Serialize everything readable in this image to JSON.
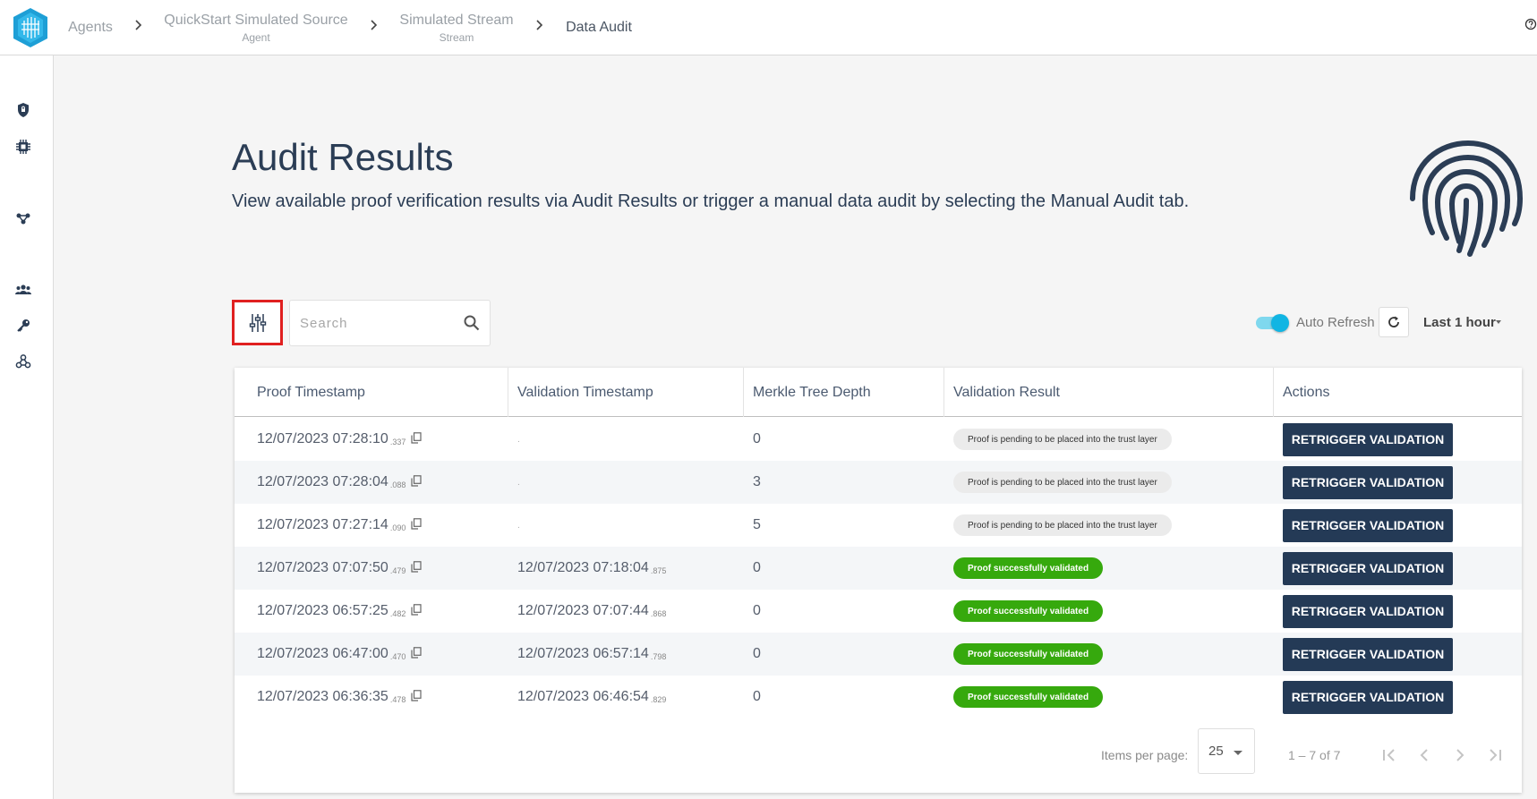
{
  "header": {
    "breadcrumbs": [
      {
        "label": "Agents",
        "sub": ""
      },
      {
        "label": "QuickStart Simulated Source",
        "sub": "Agent"
      },
      {
        "label": "Simulated Stream",
        "sub": "Stream"
      },
      {
        "label": "Data Audit",
        "sub": ""
      }
    ],
    "help_icon": "help-circle-icon"
  },
  "sidebar": {
    "icons": [
      "shield-icon",
      "chip-icon",
      "share-nodes-icon",
      "group-icon",
      "key-icon",
      "webhook-icon"
    ]
  },
  "hero": {
    "title": "Audit Results",
    "subtitle": "View available proof verification results via Audit Results or trigger a manual data audit by selecting the Manual Audit tab.",
    "icon": "fingerprint-icon"
  },
  "toolbar": {
    "search_placeholder": "Search",
    "auto_refresh_label": "Auto Refresh",
    "auto_refresh_on": true,
    "time_range": "Last 1 hour"
  },
  "table": {
    "columns": [
      "Proof Timestamp",
      "Validation Timestamp",
      "Merkle Tree Depth",
      "Validation Result",
      "Actions"
    ],
    "rows": [
      {
        "proof": "12/07/2023 07:28:10",
        "proof_ms": ".337",
        "validation": "",
        "validation_ms": "",
        "depth": "0",
        "result": "Proof is pending to be placed into the trust layer",
        "status": "pending",
        "action": "RETRIGGER VALIDATION"
      },
      {
        "proof": "12/07/2023 07:28:04",
        "proof_ms": ".088",
        "validation": "",
        "validation_ms": "",
        "depth": "3",
        "result": "Proof is pending to be placed into the trust layer",
        "status": "pending",
        "action": "RETRIGGER VALIDATION"
      },
      {
        "proof": "12/07/2023 07:27:14",
        "proof_ms": ".090",
        "validation": "",
        "validation_ms": "",
        "depth": "5",
        "result": "Proof is pending to be placed into the trust layer",
        "status": "pending",
        "action": "RETRIGGER VALIDATION"
      },
      {
        "proof": "12/07/2023 07:07:50",
        "proof_ms": ".479",
        "validation": "12/07/2023 07:18:04",
        "validation_ms": ".875",
        "depth": "0",
        "result": "Proof successfully validated",
        "status": "ok",
        "action": "RETRIGGER VALIDATION"
      },
      {
        "proof": "12/07/2023 06:57:25",
        "proof_ms": ".482",
        "validation": "12/07/2023 07:07:44",
        "validation_ms": ".868",
        "depth": "0",
        "result": "Proof successfully validated",
        "status": "ok",
        "action": "RETRIGGER VALIDATION"
      },
      {
        "proof": "12/07/2023 06:47:00",
        "proof_ms": ".470",
        "validation": "12/07/2023 06:57:14",
        "validation_ms": ".798",
        "depth": "0",
        "result": "Proof successfully validated",
        "status": "ok",
        "action": "RETRIGGER VALIDATION"
      },
      {
        "proof": "12/07/2023 06:36:35",
        "proof_ms": ".478",
        "validation": "12/07/2023 06:46:54",
        "validation_ms": ".829",
        "depth": "0",
        "result": "Proof successfully validated",
        "status": "ok",
        "action": "RETRIGGER VALIDATION"
      }
    ]
  },
  "paginator": {
    "items_per_page_label": "Items per page:",
    "items_per_page": "25",
    "range_label": "1 – 7 of 7"
  },
  "colors": {
    "primary": "#243a56",
    "success": "#36a90d",
    "accent": "#11b5e3",
    "highlight": "#e02020"
  }
}
